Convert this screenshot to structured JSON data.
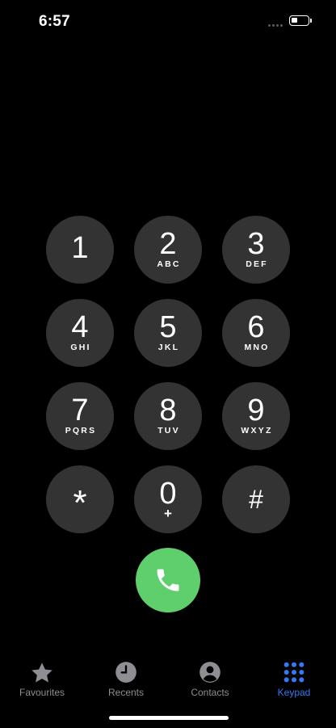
{
  "status_bar": {
    "time": "6:57",
    "battery_level": 0.4
  },
  "keypad": {
    "keys": [
      {
        "digit": "1",
        "letters": ""
      },
      {
        "digit": "2",
        "letters": "ABC"
      },
      {
        "digit": "3",
        "letters": "DEF"
      },
      {
        "digit": "4",
        "letters": "GHI"
      },
      {
        "digit": "5",
        "letters": "JKL"
      },
      {
        "digit": "6",
        "letters": "MNO"
      },
      {
        "digit": "7",
        "letters": "PQRS"
      },
      {
        "digit": "8",
        "letters": "TUV"
      },
      {
        "digit": "9",
        "letters": "WXYZ"
      },
      {
        "digit": "*",
        "letters": ""
      },
      {
        "digit": "0",
        "letters": "+"
      },
      {
        "digit": "#",
        "letters": ""
      }
    ]
  },
  "call": {
    "icon": "phone-icon",
    "color": "#5fcf6d"
  },
  "tab_bar": {
    "tabs": [
      {
        "label": "Favourites",
        "icon": "star-icon",
        "active": false
      },
      {
        "label": "Recents",
        "icon": "clock-icon",
        "active": false
      },
      {
        "label": "Contacts",
        "icon": "person-circle-icon",
        "active": false
      },
      {
        "label": "Keypad",
        "icon": "keypad-grid-icon",
        "active": true
      }
    ],
    "active_color": "#3478f6",
    "inactive_color": "#8e8e93"
  }
}
